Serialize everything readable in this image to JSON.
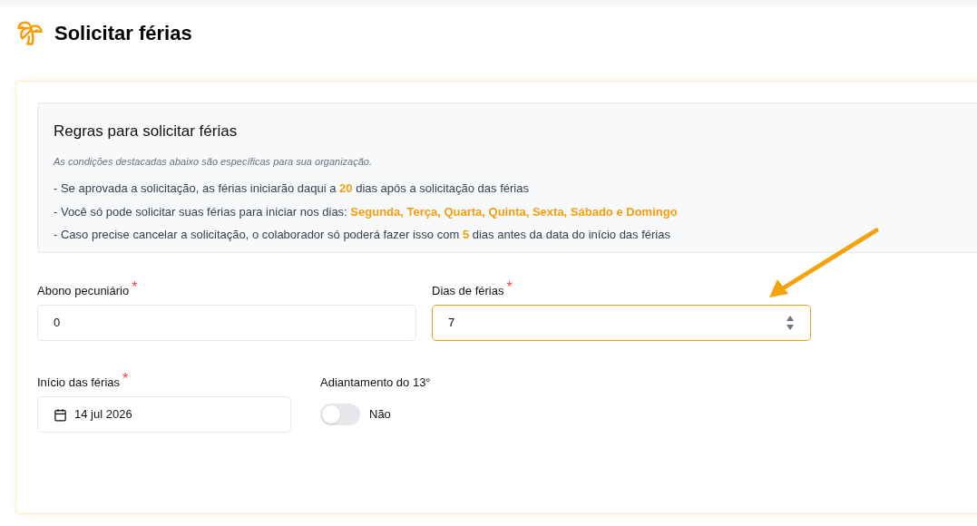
{
  "page": {
    "title": "Solicitar férias"
  },
  "rules": {
    "title": "Regras para solicitar férias",
    "note": "As condições destacadas abaixo são específicas para sua organização.",
    "lines": [
      "- Se aprovada a solicitação, as férias iniciarão daqui a **20** dias após a solicitação das férias",
      "- Você só pode solicitar suas férias para iniciar nos dias: **Segunda, Terça, Quarta, Quinta, Sexta, Sábado e Domingo**",
      "- Caso precise cancelar a solicitação, o colaborador só poderá fazer isso com **5** dias antes da data do início das férias"
    ]
  },
  "fields": [
    {
      "kind": "text",
      "label": "Abono pecuniário",
      "required_mark": "*",
      "value": "0",
      "focused": false
    },
    {
      "kind": "number",
      "label": "Dias de férias",
      "required_mark": "*",
      "value": "7",
      "focused": true
    },
    {
      "kind": "date",
      "label": "Início das férias",
      "required_mark": "*",
      "value": "14 jul 2026",
      "focused": false
    },
    {
      "kind": "toggle",
      "label": "Adiantamento do 13°",
      "on": false,
      "state_label": "Não"
    }
  ]
}
